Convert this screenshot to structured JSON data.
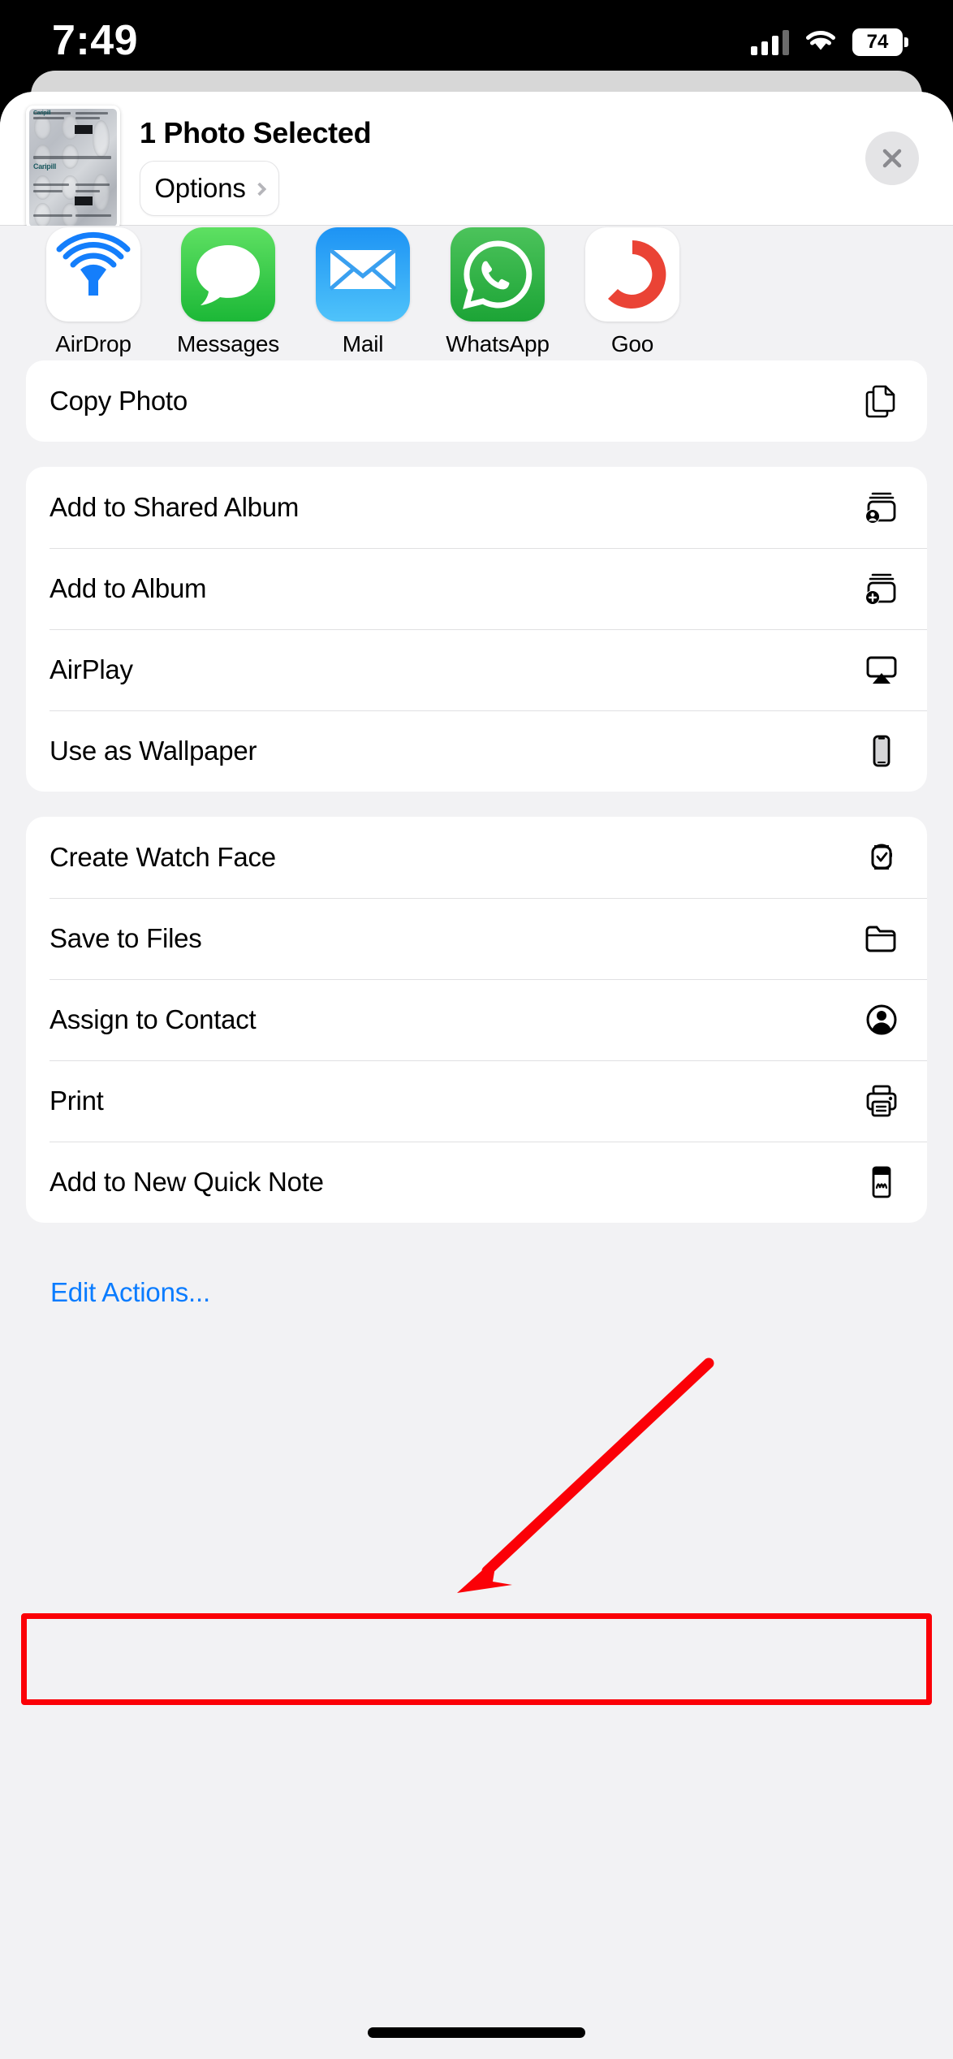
{
  "status_bar": {
    "time": "7:49",
    "cellular_icon": "cellular-signal-icon",
    "wifi_icon": "wifi-icon",
    "battery_level": "74"
  },
  "share_sheet": {
    "title": "1 Photo Selected",
    "options_label": "Options",
    "options_chevron_icon": "chevron-right-icon",
    "close_icon": "close-x-icon",
    "thumbnail": {
      "name": "photo-thumbnail",
      "caption": "Cissus Populnea Leaf Extract Tablets",
      "brand": "Caripill"
    },
    "apps": [
      {
        "label": "AirDrop",
        "icon": "airdrop-icon"
      },
      {
        "label": "Messages",
        "icon": "messages-icon"
      },
      {
        "label": "Mail",
        "icon": "mail-icon"
      },
      {
        "label": "WhatsApp",
        "icon": "whatsapp-icon"
      },
      {
        "label": "Goo",
        "icon": "google-icon"
      }
    ],
    "action_groups": [
      {
        "rows": [
          {
            "label": "Copy Photo",
            "icon": "copy-icon"
          }
        ]
      },
      {
        "rows": [
          {
            "label": "Add to Shared Album",
            "icon": "shared-album-icon"
          },
          {
            "label": "Add to Album",
            "icon": "add-album-icon"
          },
          {
            "label": "AirPlay",
            "icon": "airplay-icon"
          },
          {
            "label": "Use as Wallpaper",
            "icon": "wallpaper-iphone-icon"
          }
        ]
      },
      {
        "rows": [
          {
            "label": "Create Watch Face",
            "icon": "watch-face-icon"
          },
          {
            "label": "Save to Files",
            "icon": "folder-icon"
          },
          {
            "label": "Assign to Contact",
            "icon": "contact-person-icon"
          },
          {
            "label": "Print",
            "icon": "printer-icon"
          },
          {
            "label": "Add to New Quick Note",
            "icon": "quick-note-icon"
          }
        ]
      }
    ],
    "edit_actions_label": "Edit Actions..."
  },
  "annotations": {
    "highlight_color": "#fb0007",
    "highlight_target": "Print",
    "arrow_color": "#fb0007"
  },
  "colors": {
    "sheet_background": "#f2f2f4",
    "card_background": "#ffffff",
    "accent_blue": "#0a7cff",
    "messages_green": "#1cb837",
    "whatsapp_green": "#1ca436",
    "mail_blue": "#1d93f4",
    "airdrop_blue": "#147efb"
  }
}
